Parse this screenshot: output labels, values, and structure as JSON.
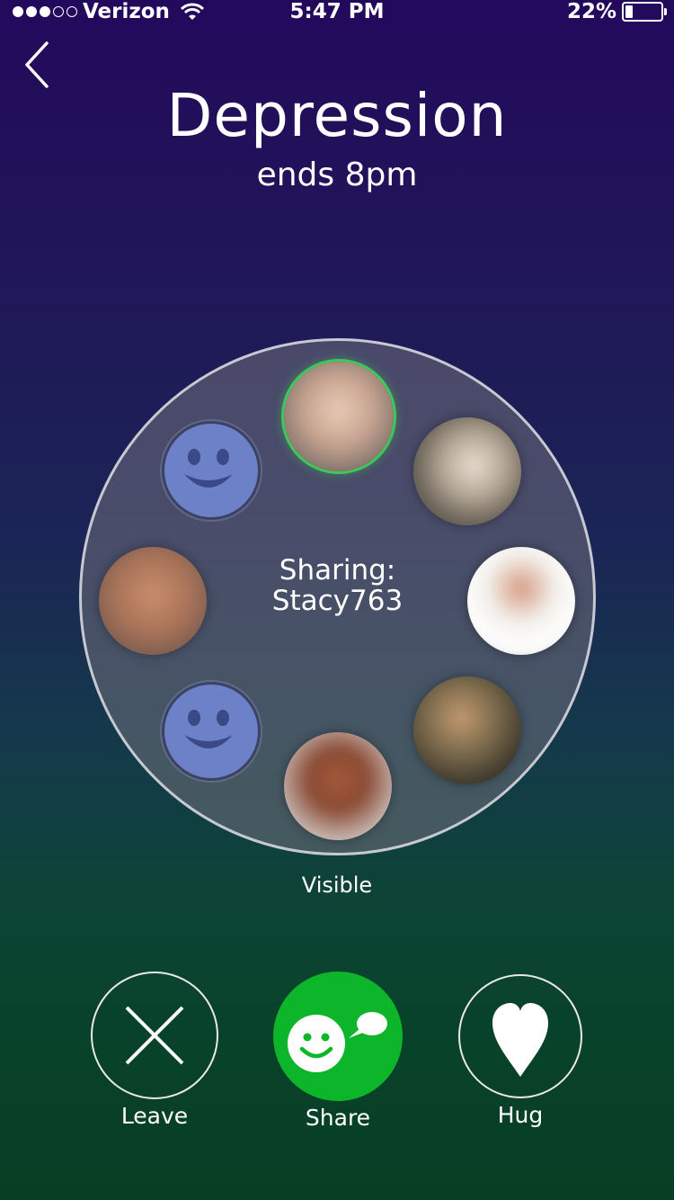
{
  "status_bar": {
    "carrier": "Verizon",
    "time": "5:47 PM",
    "battery_percent": "22%",
    "battery_level": 0.22,
    "signal_bars_filled": 3,
    "signal_bars_total": 5
  },
  "header": {
    "title": "Depression",
    "subtitle": "ends 8pm"
  },
  "circle": {
    "sharing_label": "Sharing:",
    "sharing_user": "Stacy763",
    "members": [
      {
        "type": "photo",
        "active": true
      },
      {
        "type": "photo",
        "active": false
      },
      {
        "type": "photo",
        "active": false
      },
      {
        "type": "photo",
        "active": false
      },
      {
        "type": "photo",
        "active": false
      },
      {
        "type": "smiley",
        "active": false
      },
      {
        "type": "photo",
        "active": false
      },
      {
        "type": "smiley",
        "active": false
      }
    ]
  },
  "visibility_label": "Visible",
  "actions": {
    "leave_label": "Leave",
    "share_label": "Share",
    "hug_label": "Hug"
  },
  "colors": {
    "accent_green": "#0db52a",
    "active_ring": "#3ec85a",
    "smiley_blue": "#6d81c9"
  }
}
